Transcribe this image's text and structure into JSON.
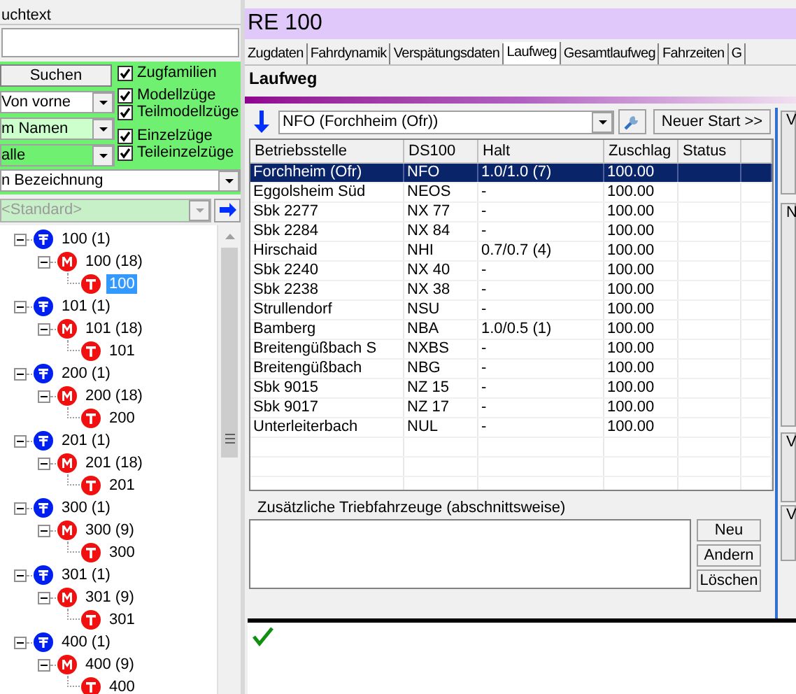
{
  "search_panel": {
    "header": "uchtext",
    "search_button": "Suchen",
    "checkboxes": [
      {
        "label": "Zugfamilien",
        "checked": true
      },
      {
        "label": "Modellzüge",
        "checked": true
      },
      {
        "label": "Teilmodellzüge",
        "checked": true
      },
      {
        "label": "Einzelzüge",
        "checked": true
      },
      {
        "label": "Teileinzelzüge",
        "checked": true
      }
    ],
    "dropdowns": [
      "Von vorne",
      "m Namen",
      "alle"
    ],
    "sort_dropdown": "n Bezeichnung",
    "filter_dropdown": {
      "value": "<Standard>",
      "disabled": true
    }
  },
  "tree": [
    {
      "kind": "family",
      "label": "100 (1)",
      "expanded": true,
      "selected": false,
      "children": [
        {
          "kind": "model",
          "label": "100 (18)",
          "expanded": true,
          "selected": false,
          "children": [
            {
              "kind": "train",
              "label": "100",
              "selected": true
            }
          ]
        }
      ]
    },
    {
      "kind": "family",
      "label": "101 (1)",
      "expanded": true,
      "selected": false,
      "children": [
        {
          "kind": "model",
          "label": "101 (18)",
          "expanded": true,
          "selected": false,
          "children": [
            {
              "kind": "train",
              "label": "101",
              "selected": false
            }
          ]
        }
      ]
    },
    {
      "kind": "family",
      "label": "200 (1)",
      "expanded": true,
      "selected": false,
      "children": [
        {
          "kind": "model",
          "label": "200 (18)",
          "expanded": true,
          "selected": false,
          "children": [
            {
              "kind": "train",
              "label": "200",
              "selected": false
            }
          ]
        }
      ]
    },
    {
      "kind": "family",
      "label": "201 (1)",
      "expanded": true,
      "selected": false,
      "children": [
        {
          "kind": "model",
          "label": "201 (18)",
          "expanded": true,
          "selected": false,
          "children": [
            {
              "kind": "train",
              "label": "201",
              "selected": false
            }
          ]
        }
      ]
    },
    {
      "kind": "family",
      "label": "300 (1)",
      "expanded": true,
      "selected": false,
      "children": [
        {
          "kind": "model",
          "label": "300 (9)",
          "expanded": true,
          "selected": false,
          "children": [
            {
              "kind": "train",
              "label": "300",
              "selected": false
            }
          ]
        }
      ]
    },
    {
      "kind": "family",
      "label": "301 (1)",
      "expanded": true,
      "selected": false,
      "children": [
        {
          "kind": "model",
          "label": "301 (9)",
          "expanded": true,
          "selected": false,
          "children": [
            {
              "kind": "train",
              "label": "301",
              "selected": false
            }
          ]
        }
      ]
    },
    {
      "kind": "family",
      "label": "400 (1)",
      "expanded": true,
      "selected": false,
      "children": [
        {
          "kind": "model",
          "label": "400 (9)",
          "expanded": true,
          "selected": false,
          "children": [
            {
              "kind": "train",
              "label": "400",
              "selected": false
            }
          ]
        }
      ]
    }
  ],
  "window": {
    "title": "RE 100"
  },
  "tabs": [
    {
      "label": "Zugdaten",
      "selected": false
    },
    {
      "label": "Fahrdynamik",
      "selected": false
    },
    {
      "label": "Verspätungsdaten",
      "selected": false
    },
    {
      "label": "Laufweg",
      "selected": true
    },
    {
      "label": "Gesamtlaufweg",
      "selected": false
    },
    {
      "label": "Fahrzeiten",
      "selected": false
    },
    {
      "label": "G",
      "selected": false
    }
  ],
  "section_title": "Laufweg",
  "station_combo": "NFO (Forchheim (Ofr))",
  "new_start_button": "Neuer Start >>",
  "table": {
    "columns": [
      "Betriebsstelle",
      "DS100",
      "Halt",
      "Zuschlag",
      "Status"
    ],
    "rows": [
      {
        "cells": [
          "Forchheim (Ofr)",
          "NFO",
          "1.0/1.0 (7)",
          "100.00",
          ""
        ],
        "selected": true
      },
      {
        "cells": [
          "Eggolsheim Süd",
          "NEOS",
          "-",
          "100.00",
          ""
        ],
        "selected": false
      },
      {
        "cells": [
          "Sbk 2277",
          "NX 77",
          "-",
          "100.00",
          ""
        ],
        "selected": false
      },
      {
        "cells": [
          "Sbk 2284",
          "NX 84",
          "-",
          "100.00",
          ""
        ],
        "selected": false
      },
      {
        "cells": [
          "Hirschaid",
          "NHI",
          "0.7/0.7 (4)",
          "100.00",
          ""
        ],
        "selected": false
      },
      {
        "cells": [
          "Sbk 2240",
          "NX 40",
          "-",
          "100.00",
          ""
        ],
        "selected": false
      },
      {
        "cells": [
          "Sbk 2238",
          "NX 38",
          "-",
          "100.00",
          ""
        ],
        "selected": false
      },
      {
        "cells": [
          "Strullendorf",
          "NSU",
          "-",
          "100.00",
          ""
        ],
        "selected": false
      },
      {
        "cells": [
          "Bamberg",
          "NBA",
          "1.0/0.5 (1)",
          "100.00",
          ""
        ],
        "selected": false
      },
      {
        "cells": [
          "Breitengüßbach S",
          "NXBS",
          "-",
          "100.00",
          ""
        ],
        "selected": false
      },
      {
        "cells": [
          "Breitengüßbach",
          "NBG",
          "-",
          "100.00",
          ""
        ],
        "selected": false
      },
      {
        "cells": [
          "Sbk 9015",
          "NZ 15",
          "-",
          "100.00",
          ""
        ],
        "selected": false
      },
      {
        "cells": [
          "Sbk 9017",
          "NZ 17",
          "-",
          "100.00",
          ""
        ],
        "selected": false
      },
      {
        "cells": [
          "Unterleiterbach",
          "NUL",
          "-",
          "100.00",
          ""
        ],
        "selected": false
      }
    ]
  },
  "extra_engines": {
    "label": "Zusätzliche Triebfahrzeuge (abschnittsweise)",
    "buttons": [
      "Neu",
      "Andern",
      "Löschen"
    ]
  },
  "side_groups": [
    "V",
    "N",
    "V",
    "V"
  ]
}
